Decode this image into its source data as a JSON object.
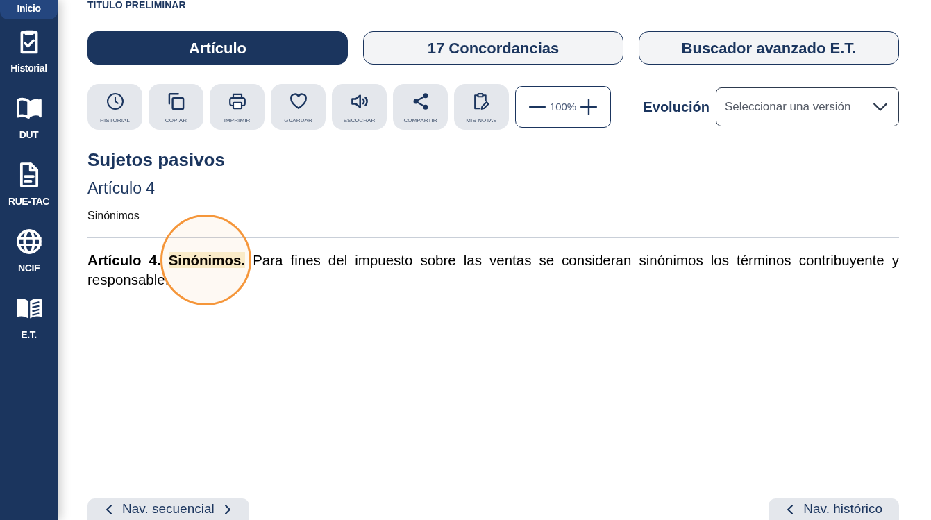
{
  "sidebar": {
    "items": [
      {
        "label": "Inicio",
        "selected": true
      },
      {
        "label": "Historial",
        "selected": false
      },
      {
        "label": "DUT",
        "selected": false
      },
      {
        "label": "RUE-TAC",
        "selected": false
      },
      {
        "label": "NCIF",
        "selected": false
      },
      {
        "label": "E.T.",
        "selected": false
      }
    ]
  },
  "breadcrumb": "TITULO PRELIMINAR",
  "tabs": [
    {
      "label": "Artículo",
      "selected": true
    },
    {
      "label": "17 Concordancias",
      "selected": false
    },
    {
      "label": "Buscador avanzado E.T.",
      "selected": false
    }
  ],
  "toolbar": {
    "actions": [
      {
        "label": "HISTORIAL"
      },
      {
        "label": "COPIAR"
      },
      {
        "label": "IMPRIMIR"
      },
      {
        "label": "GUARDAR"
      },
      {
        "label": "ESCUCHAR"
      },
      {
        "label": "COMPARTIR"
      },
      {
        "label": "MIS NOTAS"
      }
    ],
    "zoom": {
      "value": "100%"
    }
  },
  "evolution": {
    "label": "Evolución",
    "select": {
      "placeholder": "Seleccionar una versión"
    }
  },
  "article": {
    "section": "Sujetos pasivos",
    "number": "Artículo 4",
    "subtitle": "Sinónimos",
    "body": [
      {
        "text": "Artículo 4.",
        "bold": true,
        "highlighted": false
      },
      {
        "text": "Sinónimos.",
        "bold": true,
        "highlighted": true
      },
      {
        "text": "Para fines del impuesto sobre las ventas se consideran sinónimos los términos contribuyente y responsable.",
        "bold": false,
        "highlighted": false
      }
    ]
  },
  "footer_nav": [
    {
      "label": "Nav. secuencial",
      "next_arrow": true
    },
    {
      "label": "Nav. histórico",
      "next_arrow": false
    }
  ]
}
